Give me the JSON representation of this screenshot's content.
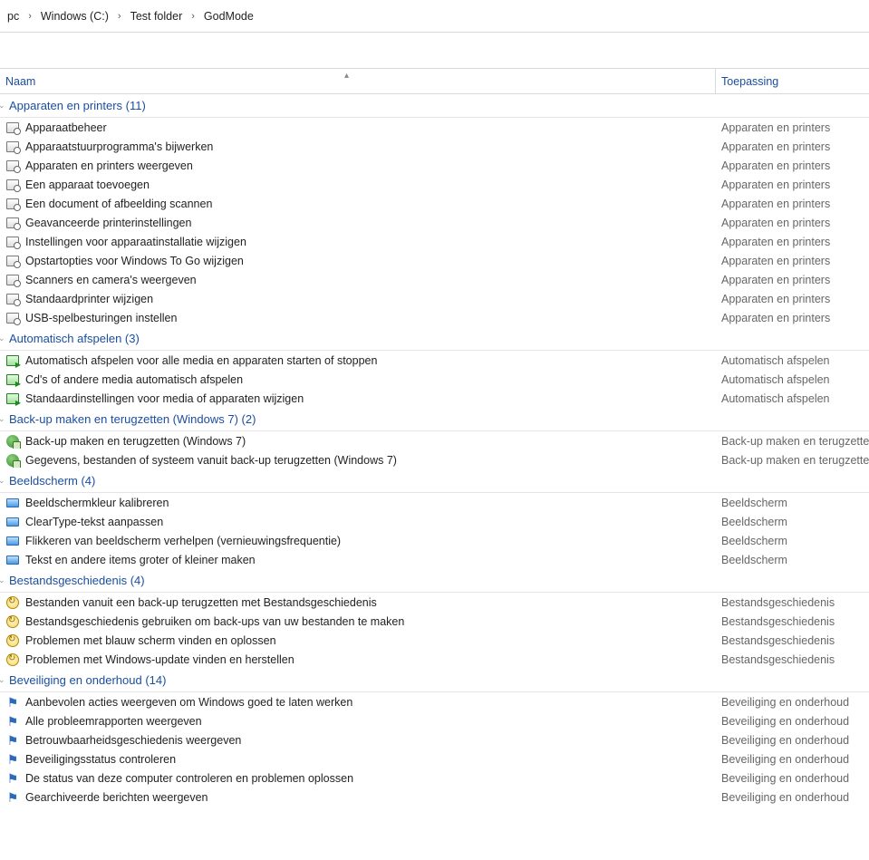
{
  "breadcrumb": [
    "pc",
    "Windows (C:)",
    "Test folder",
    "GodMode"
  ],
  "columns": {
    "name": "Naam",
    "app": "Toepassing"
  },
  "groups": [
    {
      "title": "Apparaten en printers (11)",
      "icon": "device",
      "app": "Apparaten en printers",
      "items": [
        "Apparaatbeheer",
        "Apparaatstuurprogramma's bijwerken",
        "Apparaten en printers weergeven",
        "Een apparaat toevoegen",
        "Een document of afbeelding scannen",
        "Geavanceerde printerinstellingen",
        "Instellingen voor apparaatinstallatie wijzigen",
        "Opstartopties voor Windows To Go wijzigen",
        "Scanners en camera's weergeven",
        "Standaardprinter wijzigen",
        "USB-spelbesturingen instellen"
      ]
    },
    {
      "title": "Automatisch afspelen (3)",
      "icon": "auto",
      "app": "Automatisch afspelen",
      "items": [
        "Automatisch afspelen voor alle media en apparaten starten of stoppen",
        "Cd's of andere media automatisch afspelen",
        "Standaardinstellingen voor media of apparaten wijzigen"
      ]
    },
    {
      "title": "Back-up maken en terugzetten (Windows 7) (2)",
      "icon": "backup",
      "app": "Back-up maken en terugzetten",
      "items": [
        "Back-up maken en terugzetten (Windows 7)",
        "Gegevens, bestanden of systeem vanuit back-up terugzetten (Windows 7)"
      ]
    },
    {
      "title": "Beeldscherm (4)",
      "icon": "screen",
      "app": "Beeldscherm",
      "items": [
        "Beeldschermkleur kalibreren",
        "ClearType-tekst aanpassen",
        "Flikkeren van beeldscherm verhelpen (vernieuwingsfrequentie)",
        "Tekst en andere items groter of kleiner maken"
      ]
    },
    {
      "title": "Bestandsgeschiedenis (4)",
      "icon": "hist",
      "app": "Bestandsgeschiedenis",
      "items": [
        "Bestanden vanuit een back-up terugzetten met Bestandsgeschiedenis",
        "Bestandsgeschiedenis gebruiken om back-ups van uw bestanden te maken",
        "Problemen met blauw scherm vinden en oplossen",
        "Problemen met Windows-update vinden en herstellen"
      ]
    },
    {
      "title": "Beveiliging en onderhoud (14)",
      "icon": "flag",
      "app": "Beveiliging en onderhoud",
      "items": [
        "Aanbevolen acties weergeven om Windows goed te laten werken",
        "Alle probleemrapporten weergeven",
        "Betrouwbaarheidsgeschiedenis weergeven",
        "Beveiligingsstatus controleren",
        "De status van deze computer controleren en problemen oplossen",
        "Gearchiveerde berichten weergeven"
      ]
    }
  ]
}
